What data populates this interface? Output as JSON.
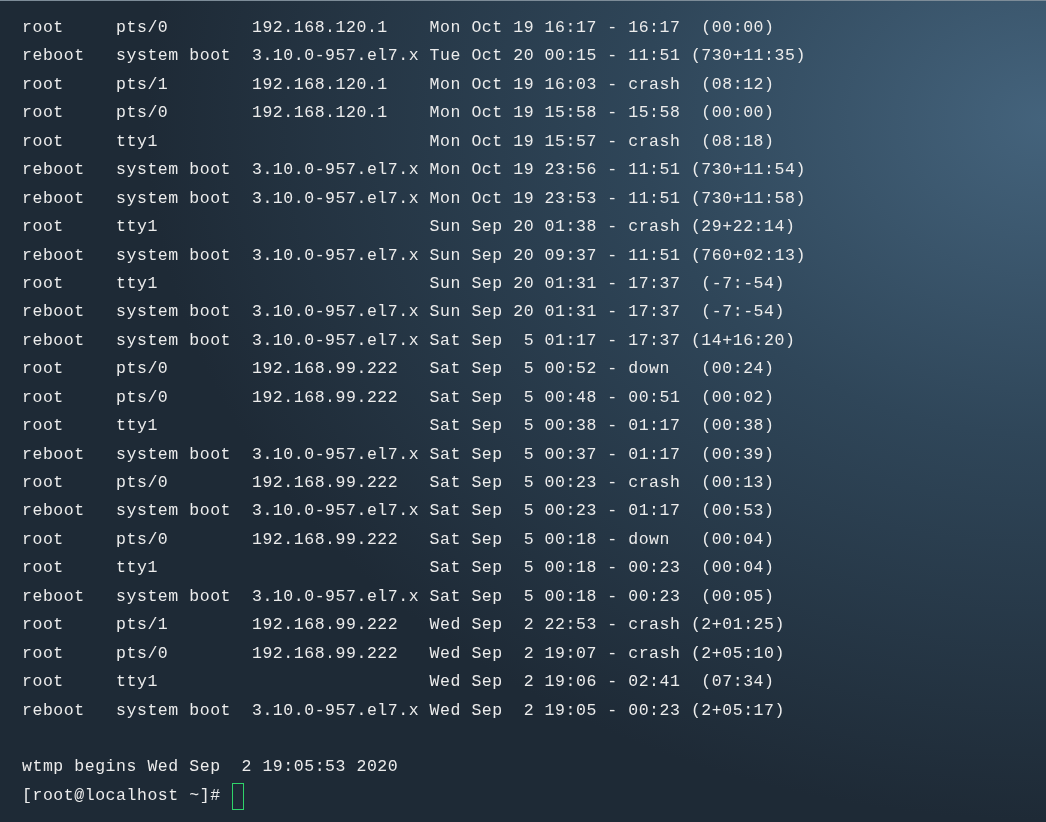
{
  "lines": [
    "root     pts/0        192.168.120.1    Mon Oct 19 16:17 - 16:17  (00:00)",
    "reboot   system boot  3.10.0-957.el7.x Tue Oct 20 00:15 - 11:51 (730+11:35)",
    "root     pts/1        192.168.120.1    Mon Oct 19 16:03 - crash  (08:12)",
    "root     pts/0        192.168.120.1    Mon Oct 19 15:58 - 15:58  (00:00)",
    "root     tty1                          Mon Oct 19 15:57 - crash  (08:18)",
    "reboot   system boot  3.10.0-957.el7.x Mon Oct 19 23:56 - 11:51 (730+11:54)",
    "reboot   system boot  3.10.0-957.el7.x Mon Oct 19 23:53 - 11:51 (730+11:58)",
    "root     tty1                          Sun Sep 20 01:38 - crash (29+22:14)",
    "reboot   system boot  3.10.0-957.el7.x Sun Sep 20 09:37 - 11:51 (760+02:13)",
    "root     tty1                          Sun Sep 20 01:31 - 17:37  (-7:-54)",
    "reboot   system boot  3.10.0-957.el7.x Sun Sep 20 01:31 - 17:37  (-7:-54)",
    "reboot   system boot  3.10.0-957.el7.x Sat Sep  5 01:17 - 17:37 (14+16:20)",
    "root     pts/0        192.168.99.222   Sat Sep  5 00:52 - down   (00:24)",
    "root     pts/0        192.168.99.222   Sat Sep  5 00:48 - 00:51  (00:02)",
    "root     tty1                          Sat Sep  5 00:38 - 01:17  (00:38)",
    "reboot   system boot  3.10.0-957.el7.x Sat Sep  5 00:37 - 01:17  (00:39)",
    "root     pts/0        192.168.99.222   Sat Sep  5 00:23 - crash  (00:13)",
    "reboot   system boot  3.10.0-957.el7.x Sat Sep  5 00:23 - 01:17  (00:53)",
    "root     pts/0        192.168.99.222   Sat Sep  5 00:18 - down   (00:04)",
    "root     tty1                          Sat Sep  5 00:18 - 00:23  (00:04)",
    "reboot   system boot  3.10.0-957.el7.x Sat Sep  5 00:18 - 00:23  (00:05)",
    "root     pts/1        192.168.99.222   Wed Sep  2 22:53 - crash (2+01:25)",
    "root     pts/0        192.168.99.222   Wed Sep  2 19:07 - crash (2+05:10)",
    "root     tty1                          Wed Sep  2 19:06 - 02:41  (07:34)",
    "reboot   system boot  3.10.0-957.el7.x Wed Sep  2 19:05 - 00:23 (2+05:17)"
  ],
  "footer": "wtmp begins Wed Sep  2 19:05:53 2020",
  "prompt": "[root@localhost ~]#"
}
